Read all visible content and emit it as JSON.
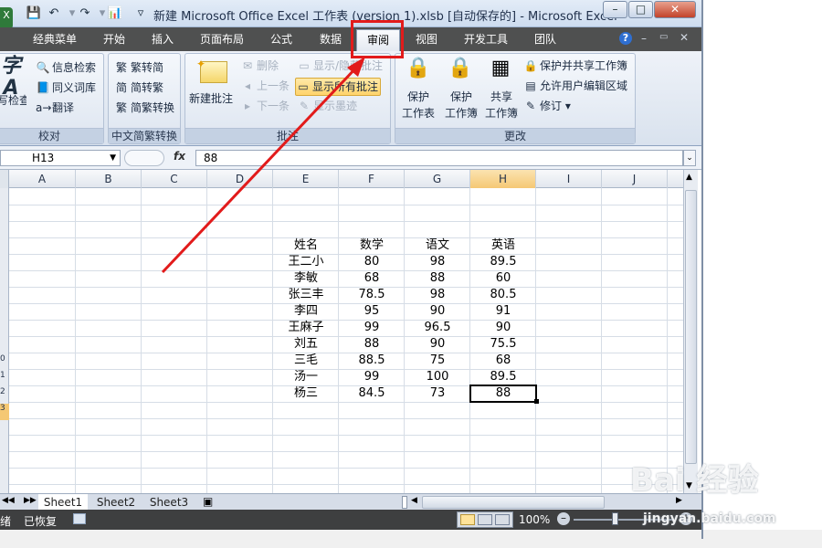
{
  "window": {
    "title": "新建 Microsoft Office Excel 工作表 (version 1).xlsb [自动保存的] - Microsoft Excel",
    "controls": [
      "–",
      "□",
      "✕"
    ]
  },
  "quick_access": {
    "icons": [
      "excel-logo-icon",
      "save-icon",
      "undo-icon",
      "redo-icon",
      "chart-icon",
      "customize-arrow-icon"
    ]
  },
  "ribbon_tabs": {
    "items": [
      {
        "label": "经典菜单",
        "active": false
      },
      {
        "label": "开始",
        "active": false
      },
      {
        "label": "插入",
        "active": false
      },
      {
        "label": "页面布局",
        "active": false
      },
      {
        "label": "公式",
        "active": false
      },
      {
        "label": "数据",
        "active": false
      },
      {
        "label": "审阅",
        "active": true
      },
      {
        "label": "视图",
        "active": false
      },
      {
        "label": "开发工具",
        "active": false
      },
      {
        "label": "团队",
        "active": false
      }
    ],
    "right_icons": [
      "help-icon",
      "minimize-icon",
      "restore-icon",
      "close-icon"
    ]
  },
  "ribbon": {
    "proofing": {
      "label": "校对",
      "big_button": "拼写检查",
      "big_button_glyph": "字A",
      "items": [
        "信息检索",
        "同义词库",
        "翻译"
      ]
    },
    "chinese": {
      "label": "中文简繁转换",
      "items": [
        "繁转简",
        "简转繁",
        "简繁转换"
      ]
    },
    "comments": {
      "label": "批注",
      "new_comment": "新建批注",
      "col1": [
        "删除",
        "上一条",
        "下一条"
      ],
      "col2": [
        "显示/隐藏批注",
        "显示所有批注",
        "显示墨迹"
      ]
    },
    "changes": {
      "label": "更改",
      "protect_sheet": [
        "保护",
        "工作表"
      ],
      "protect_workbook": [
        "保护",
        "工作簿"
      ],
      "share_workbook": [
        "共享",
        "工作簿"
      ],
      "items": [
        "保护并共享工作簿",
        "允许用户编辑区域",
        "修订"
      ]
    }
  },
  "formula_bar": {
    "name_box": "H13",
    "fx": "fx",
    "value": "88"
  },
  "grid": {
    "columns": [
      "A",
      "B",
      "C",
      "D",
      "E",
      "F",
      "G",
      "H",
      "I",
      "J"
    ],
    "selected_column": "H",
    "row_header_labels": [
      "0",
      "1",
      "2",
      "3"
    ],
    "headers": [
      "姓名",
      "数学",
      "语文",
      "英语"
    ],
    "rows": [
      [
        "王二小",
        "80",
        "98",
        "89.5"
      ],
      [
        "李敏",
        "68",
        "88",
        "60"
      ],
      [
        "张三丰",
        "78.5",
        "98",
        "80.5"
      ],
      [
        "李四",
        "95",
        "90",
        "91"
      ],
      [
        "王麻子",
        "99",
        "96.5",
        "90"
      ],
      [
        "刘五",
        "88",
        "90",
        "75.5"
      ],
      [
        "三毛",
        "88.5",
        "75",
        "68"
      ],
      [
        "汤一",
        "99",
        "100",
        "89.5"
      ],
      [
        "杨三",
        "84.5",
        "73",
        "88"
      ]
    ],
    "active_cell": "H13"
  },
  "sheet_tabs": {
    "items": [
      "Sheet1",
      "Sheet2",
      "Sheet3"
    ],
    "active": "Sheet1"
  },
  "status_bar": {
    "ready": "绪",
    "recovered": "已恢复",
    "zoom": "100%"
  },
  "watermark": {
    "text_line1": "Bai 经验",
    "text_line2": "jingyan.baidu.com"
  },
  "colors": {
    "highlight_red": "#e21b1b",
    "tab_bar": "#4f5050",
    "status_bar": "#3e3f40",
    "selected_header": "#f5c874"
  }
}
